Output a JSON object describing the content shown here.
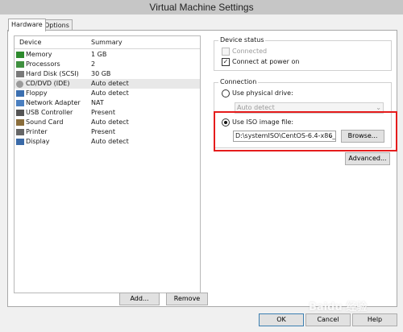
{
  "window": {
    "title": "Virtual Machine Settings"
  },
  "tabs": [
    {
      "label": "Hardware"
    },
    {
      "label": "Options"
    }
  ],
  "device_list": {
    "headers": {
      "device": "Device",
      "summary": "Summary"
    },
    "rows": [
      {
        "icon": "memory-icon",
        "device": "Memory",
        "summary": "1 GB"
      },
      {
        "icon": "processor-icon",
        "device": "Processors",
        "summary": "2"
      },
      {
        "icon": "hard-disk-icon",
        "device": "Hard Disk (SCSI)",
        "summary": "30 GB"
      },
      {
        "icon": "cd-dvd-icon",
        "device": "CD/DVD (IDE)",
        "summary": "Auto detect",
        "selected": true
      },
      {
        "icon": "floppy-icon",
        "device": "Floppy",
        "summary": "Auto detect"
      },
      {
        "icon": "network-adapter-icon",
        "device": "Network Adapter",
        "summary": "NAT"
      },
      {
        "icon": "usb-controller-icon",
        "device": "USB Controller",
        "summary": "Present"
      },
      {
        "icon": "sound-card-icon",
        "device": "Sound Card",
        "summary": "Auto detect"
      },
      {
        "icon": "printer-icon",
        "device": "Printer",
        "summary": "Present"
      },
      {
        "icon": "display-icon",
        "device": "Display",
        "summary": "Auto detect"
      }
    ],
    "add_label": "Add...",
    "remove_label": "Remove"
  },
  "device_status": {
    "title": "Device status",
    "connected_label": "Connected",
    "connected_checked": false,
    "connected_enabled": false,
    "connect_at_power_on_label": "Connect at power on",
    "connect_at_power_on_checked": true
  },
  "connection": {
    "title": "Connection",
    "physical_drive_label": "Use physical drive:",
    "physical_drive_selected": false,
    "physical_drive_value": "Auto detect",
    "iso_label": "Use ISO image file:",
    "iso_selected": true,
    "iso_path": "D:\\systemISO\\CentOS-6.4-x86_",
    "browse_label": "Browse...",
    "advanced_label": "Advanced..."
  },
  "footer": {
    "ok_label": "OK",
    "cancel_label": "Cancel",
    "help_label": "Help"
  },
  "highlight_color": "#e51c1c",
  "watermark_text": "Baidu 经验"
}
